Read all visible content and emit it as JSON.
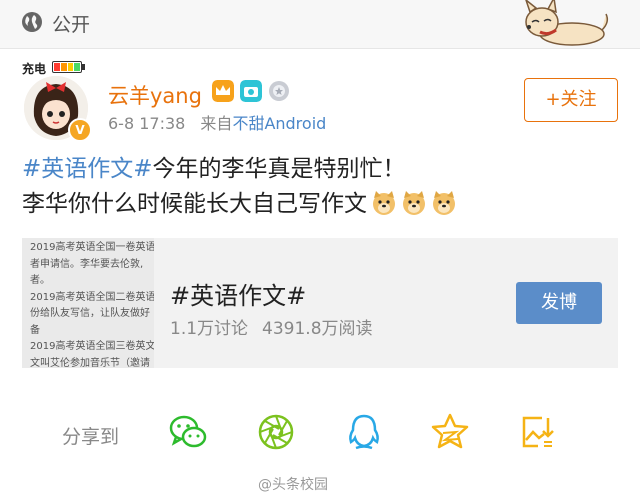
{
  "topbar": {
    "visibility_label": "公开",
    "globe_icon": "globe-icon",
    "sticker": "shiba-dog-sticker"
  },
  "author": {
    "charge_label": "充电",
    "battery_colors": [
      "#ff3b30",
      "#ff9500",
      "#ffcc00",
      "#4cd964"
    ],
    "name": "云羊yang",
    "badges": [
      "crown-badge-icon",
      "camera-badge-icon",
      "medal-badge-icon"
    ],
    "date": "6-8 17:38",
    "source_prefix": "来自",
    "source": "不甜Android",
    "verified_icon": "verified-v-icon"
  },
  "follow_button": {
    "label": "+关注"
  },
  "post": {
    "hashtag": "#英语作文#",
    "line1_rest": "今年的李华真是特别忙！",
    "line2": "李华你什么时候能长大自己写作文",
    "emojis": [
      "doge-emoji",
      "doge-emoji",
      "doge-emoji"
    ]
  },
  "topic_card": {
    "thumbnail_lines": [
      "2019高考英语全国一卷英语",
      "者申请信。李华要去伦敦,",
      "者。",
      "2019高考英语全国二卷英语",
      "份给队友写信，让队友做好",
      "备",
      "2019高考英语全国三卷英文",
      "文叫艾伦参加音乐节（邀请"
    ],
    "title": "#英语作文#",
    "discussions": "1.1万讨论",
    "reads": "4391.8万阅读",
    "post_button": "发博"
  },
  "share": {
    "label": "分享到",
    "targets": [
      "wechat-icon",
      "moments-icon",
      "qq-icon",
      "qzone-icon",
      "screenshot-share-icon"
    ]
  },
  "watermark": "@头条校园",
  "colors": {
    "accent_orange": "#e8720c",
    "link_blue": "#4a86c8",
    "button_blue": "#5b8dc9",
    "share_green": "#2dbb2d",
    "share_qq": "#28a8e6",
    "share_yellow": "#f5b315"
  }
}
